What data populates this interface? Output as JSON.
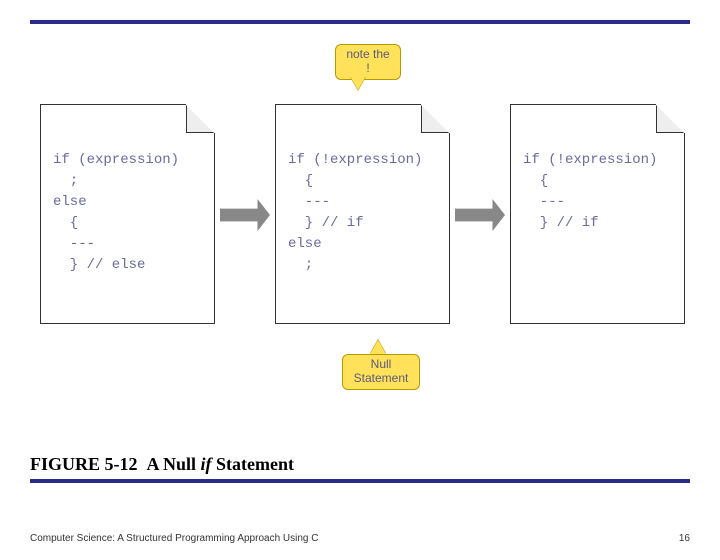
{
  "rules": {
    "color": "#2a2a8a"
  },
  "callouts": {
    "top": "note the\n!",
    "bottom": "Null\nStatement"
  },
  "snippets": {
    "a": "if (expression)\n  ;\nelse\n  {\n  ---\n  } // else",
    "b": "if (!expression)\n  {\n  ---\n  } // if\nelse\n  ;",
    "c": "if (!expression)\n  {\n  ---\n  } // if"
  },
  "caption": {
    "label": "FIGURE 5-12",
    "title_pre": "A Null ",
    "title_ital": "if",
    "title_post": " Statement"
  },
  "footer": {
    "left": "Computer Science: A Structured Programming Approach Using C",
    "page": "16"
  }
}
